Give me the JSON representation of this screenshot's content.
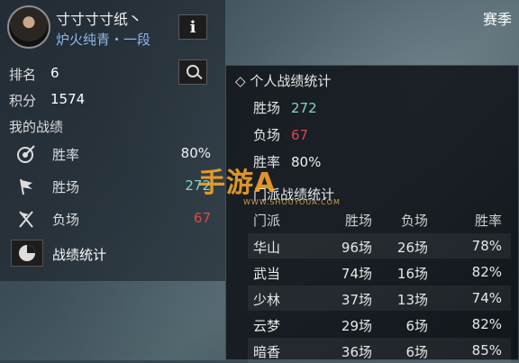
{
  "profile": {
    "name": "寸寸寸寸纸丶",
    "rank": "炉火纯青・一段"
  },
  "season_label": "赛季",
  "stats": {
    "rank_label": "排名",
    "rank_value": "6",
    "score_label": "积分",
    "score_value": "1574",
    "my_record_label": "我的战绩",
    "win_rate_label": "胜率",
    "win_rate_value": "80%",
    "wins_label": "胜场",
    "wins_value": "272",
    "losses_label": "负场",
    "losses_value": "67",
    "overview_label": "战绩统计"
  },
  "popup": {
    "title": "个人战绩统计",
    "wins_label": "胜场",
    "wins_value": "272",
    "losses_label": "负场",
    "losses_value": "67",
    "rate_label": "胜率",
    "rate_value": "80%",
    "sect_title": "门派战绩统计",
    "columns": [
      "门派",
      "胜场",
      "负场",
      "胜率"
    ],
    "rows": [
      [
        "华山",
        "96场",
        "26场",
        "78%"
      ],
      [
        "武当",
        "74场",
        "16场",
        "82%"
      ],
      [
        "少林",
        "37场",
        "13场",
        "74%"
      ],
      [
        "云梦",
        "29场",
        "6场",
        "82%"
      ],
      [
        "暗香",
        "36场",
        "6场",
        "85%"
      ]
    ]
  },
  "watermark": {
    "text": "手游A",
    "sub": "WWW.SHOUYOUA.COM"
  },
  "colors": {
    "green": "#7fd6c1",
    "red": "#e04747",
    "rank_blue": "#8fb6e8"
  },
  "icons": [
    "info-icon",
    "search-icon",
    "target-icon",
    "flag-icon",
    "crossed-flag-icon",
    "pie-chart-icon"
  ]
}
